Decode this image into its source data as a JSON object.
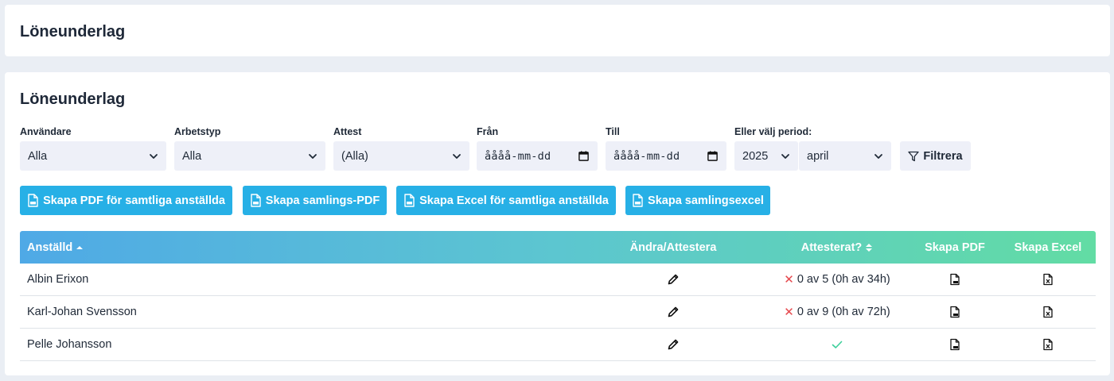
{
  "header": {
    "title": "Löneunderlag"
  },
  "main": {
    "title": "Löneunderlag",
    "filters": {
      "user": {
        "label": "Användare",
        "value": "Alla"
      },
      "worktype": {
        "label": "Arbetstyp",
        "value": "Alla"
      },
      "attest": {
        "label": "Attest",
        "value": "(Alla)"
      },
      "from": {
        "label": "Från",
        "value": "åååå-mm-dd"
      },
      "to": {
        "label": "Till",
        "value": "åååå-mm-dd"
      },
      "period": {
        "label": "Eller välj period:",
        "year": "2025",
        "month": "april"
      },
      "filter_button": "Filtrera"
    },
    "actions": {
      "pdf_all": "Skapa PDF för samtliga anställda",
      "pdf_combined": "Skapa samlings-PDF",
      "excel_all": "Skapa Excel för samtliga anställda",
      "excel_combined": "Skapa samlingsexcel"
    },
    "table": {
      "columns": {
        "employee": "Anställd",
        "edit": "Ändra/Attestera",
        "attested": "Attesterat?",
        "pdf": "Skapa PDF",
        "excel": "Skapa Excel"
      },
      "rows": [
        {
          "name": "Albin Erixon",
          "status": "0 av 5 (0h av 34h)",
          "attested": false
        },
        {
          "name": "Karl-Johan Svensson",
          "status": "0 av 9 (0h av 72h)",
          "attested": false
        },
        {
          "name": "Pelle Johansson",
          "status": "",
          "attested": true
        }
      ]
    },
    "colors": {
      "accent": "#27b0e6",
      "error": "#e5484d",
      "success": "#3ccf9a"
    },
    "icons": [
      "chevron-down-icon",
      "calendar-icon",
      "filter-icon",
      "pdf-file-icon",
      "excel-file-icon",
      "pencil-icon",
      "x-mark-icon",
      "check-icon",
      "sort-up-icon",
      "sort-icon"
    ]
  }
}
